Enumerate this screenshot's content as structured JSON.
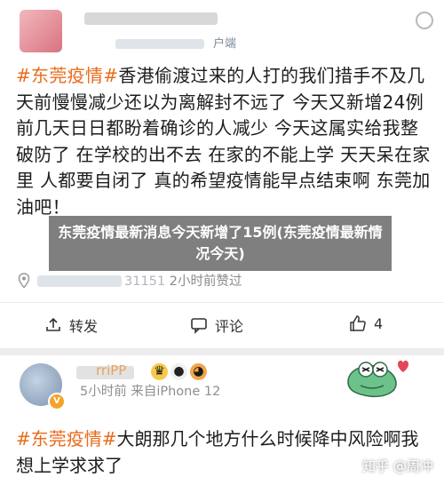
{
  "post1": {
    "client_suffix": "户端",
    "hashtag": "#东莞疫情#",
    "body_text": "香港偷渡过来的人打的我们措手不及几天前慢慢减少还以为离解封不远了 今天又新增24例 前几天日日都盼着确诊的人减少 今天这属实给我整破防了 在学校的出不去 在家的不能上学 天天呆在家里 人都要自闭了 真的希望疫情能早点结束啊 东莞加油吧！",
    "meta_time": "2小时前赞过",
    "blurred_meta_fragment": "31151",
    "actions": {
      "repost": "转发",
      "comment": "评论",
      "like": "4"
    }
  },
  "overlay": {
    "headline": "东莞疫情最新消息今天新增了15例(东莞疫情最新情况今天)"
  },
  "post2": {
    "username_fragment": "rriPP",
    "meta_time": "5小时前",
    "meta_client": "来自iPhone 12",
    "hashtag": "#东莞疫情#",
    "body_text": "大朗那几个地方什么时候降中风险啊我想上学求求了",
    "watermark": "知乎 @周冲"
  },
  "colors": {
    "hashtag": "#ea6b1a",
    "overlay_bg": "#5f5f5f"
  }
}
